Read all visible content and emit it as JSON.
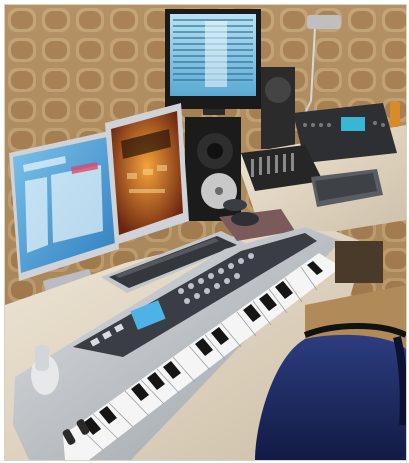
{
  "photo": {
    "subject": "home-recording-studio-desk",
    "colors": {
      "foam_wall": "#c4a071",
      "foam_shadow": "#8b6a43",
      "desk": "#e6dccb",
      "keyboard_body": "#c9cdd2",
      "keyboard_panel": "#3c4047",
      "monitor_screen_blue": "#4aa0d6",
      "chair": "#1f2d63",
      "floor": "#b08a58"
    }
  }
}
